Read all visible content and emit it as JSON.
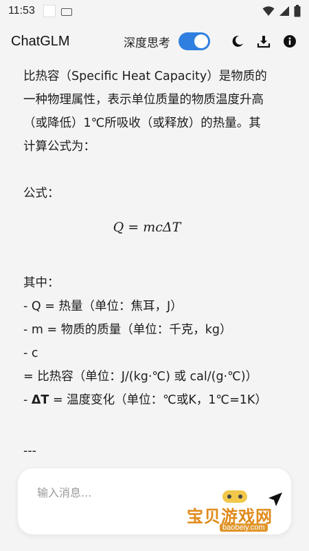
{
  "status_bar": {
    "time": "11:53"
  },
  "header": {
    "title": "ChatGLM",
    "deep_think_label": "深度思考",
    "deep_think_on": true
  },
  "message": {
    "intro": "比热容（Specific Heat Capacity）是物质的一种物理属性，表示单位质量的物质温度升高（或降低）1℃所吸收（或释放）的热量。其计算公式为：",
    "formula_label": "公式：",
    "formula": "Q = mcΔT",
    "where_label": "其中：",
    "items": [
      {
        "prefix": "- ",
        "sym": "Q",
        "text": " = 热量（单位：焦耳，J）"
      },
      {
        "prefix": "- ",
        "sym": "m",
        "text": " = 物质的质量（单位：千克，kg）"
      },
      {
        "prefix": "- ",
        "sym": "c",
        "text": " = 比热容（单位：J/(kg·℃) 或 cal/(g·℃)）"
      },
      {
        "prefix": "- ",
        "sym": "ΔT",
        "text": " = 温度变化（单位：℃或K，1℃=1K）"
      }
    ],
    "separator": "---"
  },
  "input": {
    "placeholder": "输入消息..."
  },
  "watermark": {
    "text": "宝贝游戏网",
    "url": "baobeiy.com"
  },
  "colors": {
    "accent": "#2f7fe0",
    "watermark": "#e08a1a"
  }
}
